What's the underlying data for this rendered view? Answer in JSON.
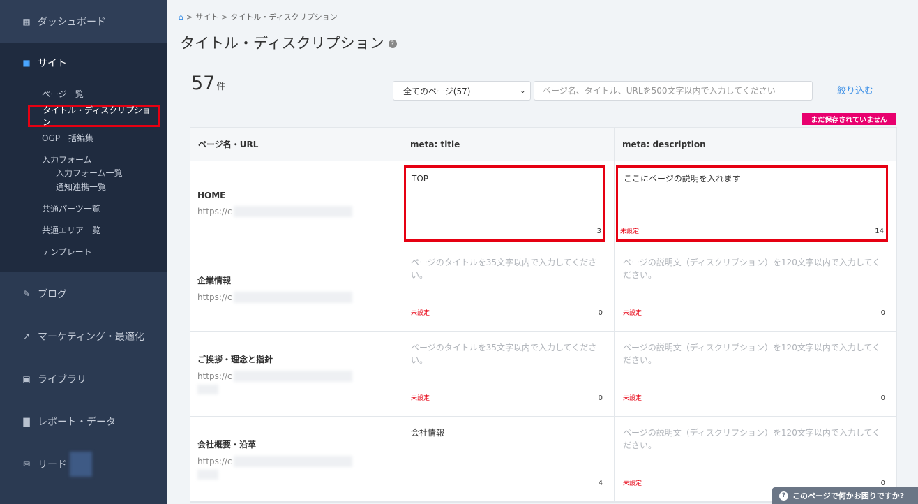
{
  "sidebar": {
    "dashboard": "ダッシュボード",
    "site": "サイト",
    "site_items": {
      "pages": "ページ一覧",
      "title_desc": "タイトル・ディスクリプション",
      "ogp": "OGP一括編集",
      "forms": "入力フォーム",
      "form_list": "入力フォーム一覧",
      "notify": "通知連携一覧",
      "parts": "共通パーツ一覧",
      "areas": "共通エリア一覧",
      "template": "テンプレート"
    },
    "blog": "ブログ",
    "marketing": "マーケティング・最適化",
    "library": "ライブラリ",
    "report": "レポート・データ",
    "lead": "リード"
  },
  "breadcrumb": {
    "sep": ">",
    "site": "サイト",
    "current": "タイトル・ディスクリプション"
  },
  "page_title": "タイトル・ディスクリプション",
  "count": {
    "value": "57",
    "unit": "件"
  },
  "filter": {
    "select_value": "全てのページ(57)",
    "search_placeholder": "ページ名、タイトル、URLを500文字以内で入力してください",
    "button": "絞り込む"
  },
  "unsaved_badge": "まだ保存されていません",
  "table": {
    "headers": [
      "ページ名・URL",
      "meta: title",
      "meta: description"
    ],
    "title_placeholder": "ページのタイトルを35文字以内で入力してください。",
    "desc_placeholder": "ページの説明文（ディスクリプション）を120文字以内で入力してください。",
    "unset": "未設定",
    "rows": [
      {
        "name": "HOME",
        "url": "https://c",
        "title": "TOP",
        "title_count": "3",
        "desc": "ここにページの説明を入れます",
        "desc_count": "14"
      },
      {
        "name": "企業情報",
        "url": "https://c",
        "title": "",
        "title_count": "0",
        "desc": "",
        "desc_count": "0"
      },
      {
        "name": "ご挨拶・理念と指針",
        "url": "https://c",
        "title": "",
        "title_count": "0",
        "desc": "",
        "desc_count": "0"
      },
      {
        "name": "会社概要・沿革",
        "url": "https://c",
        "title": "会社情報",
        "title_count": "4",
        "desc": "",
        "desc_count": "0"
      }
    ]
  },
  "help_bar": "このページで何かお困りですか?",
  "icons": {
    "dashboard": "dashboard-icon",
    "site": "site-icon",
    "blog": "pencil-icon",
    "marketing": "trend-icon",
    "library": "image-icon",
    "report": "bar-chart-icon",
    "lead": "mail-icon",
    "home": "home-icon",
    "help": "question-icon"
  }
}
